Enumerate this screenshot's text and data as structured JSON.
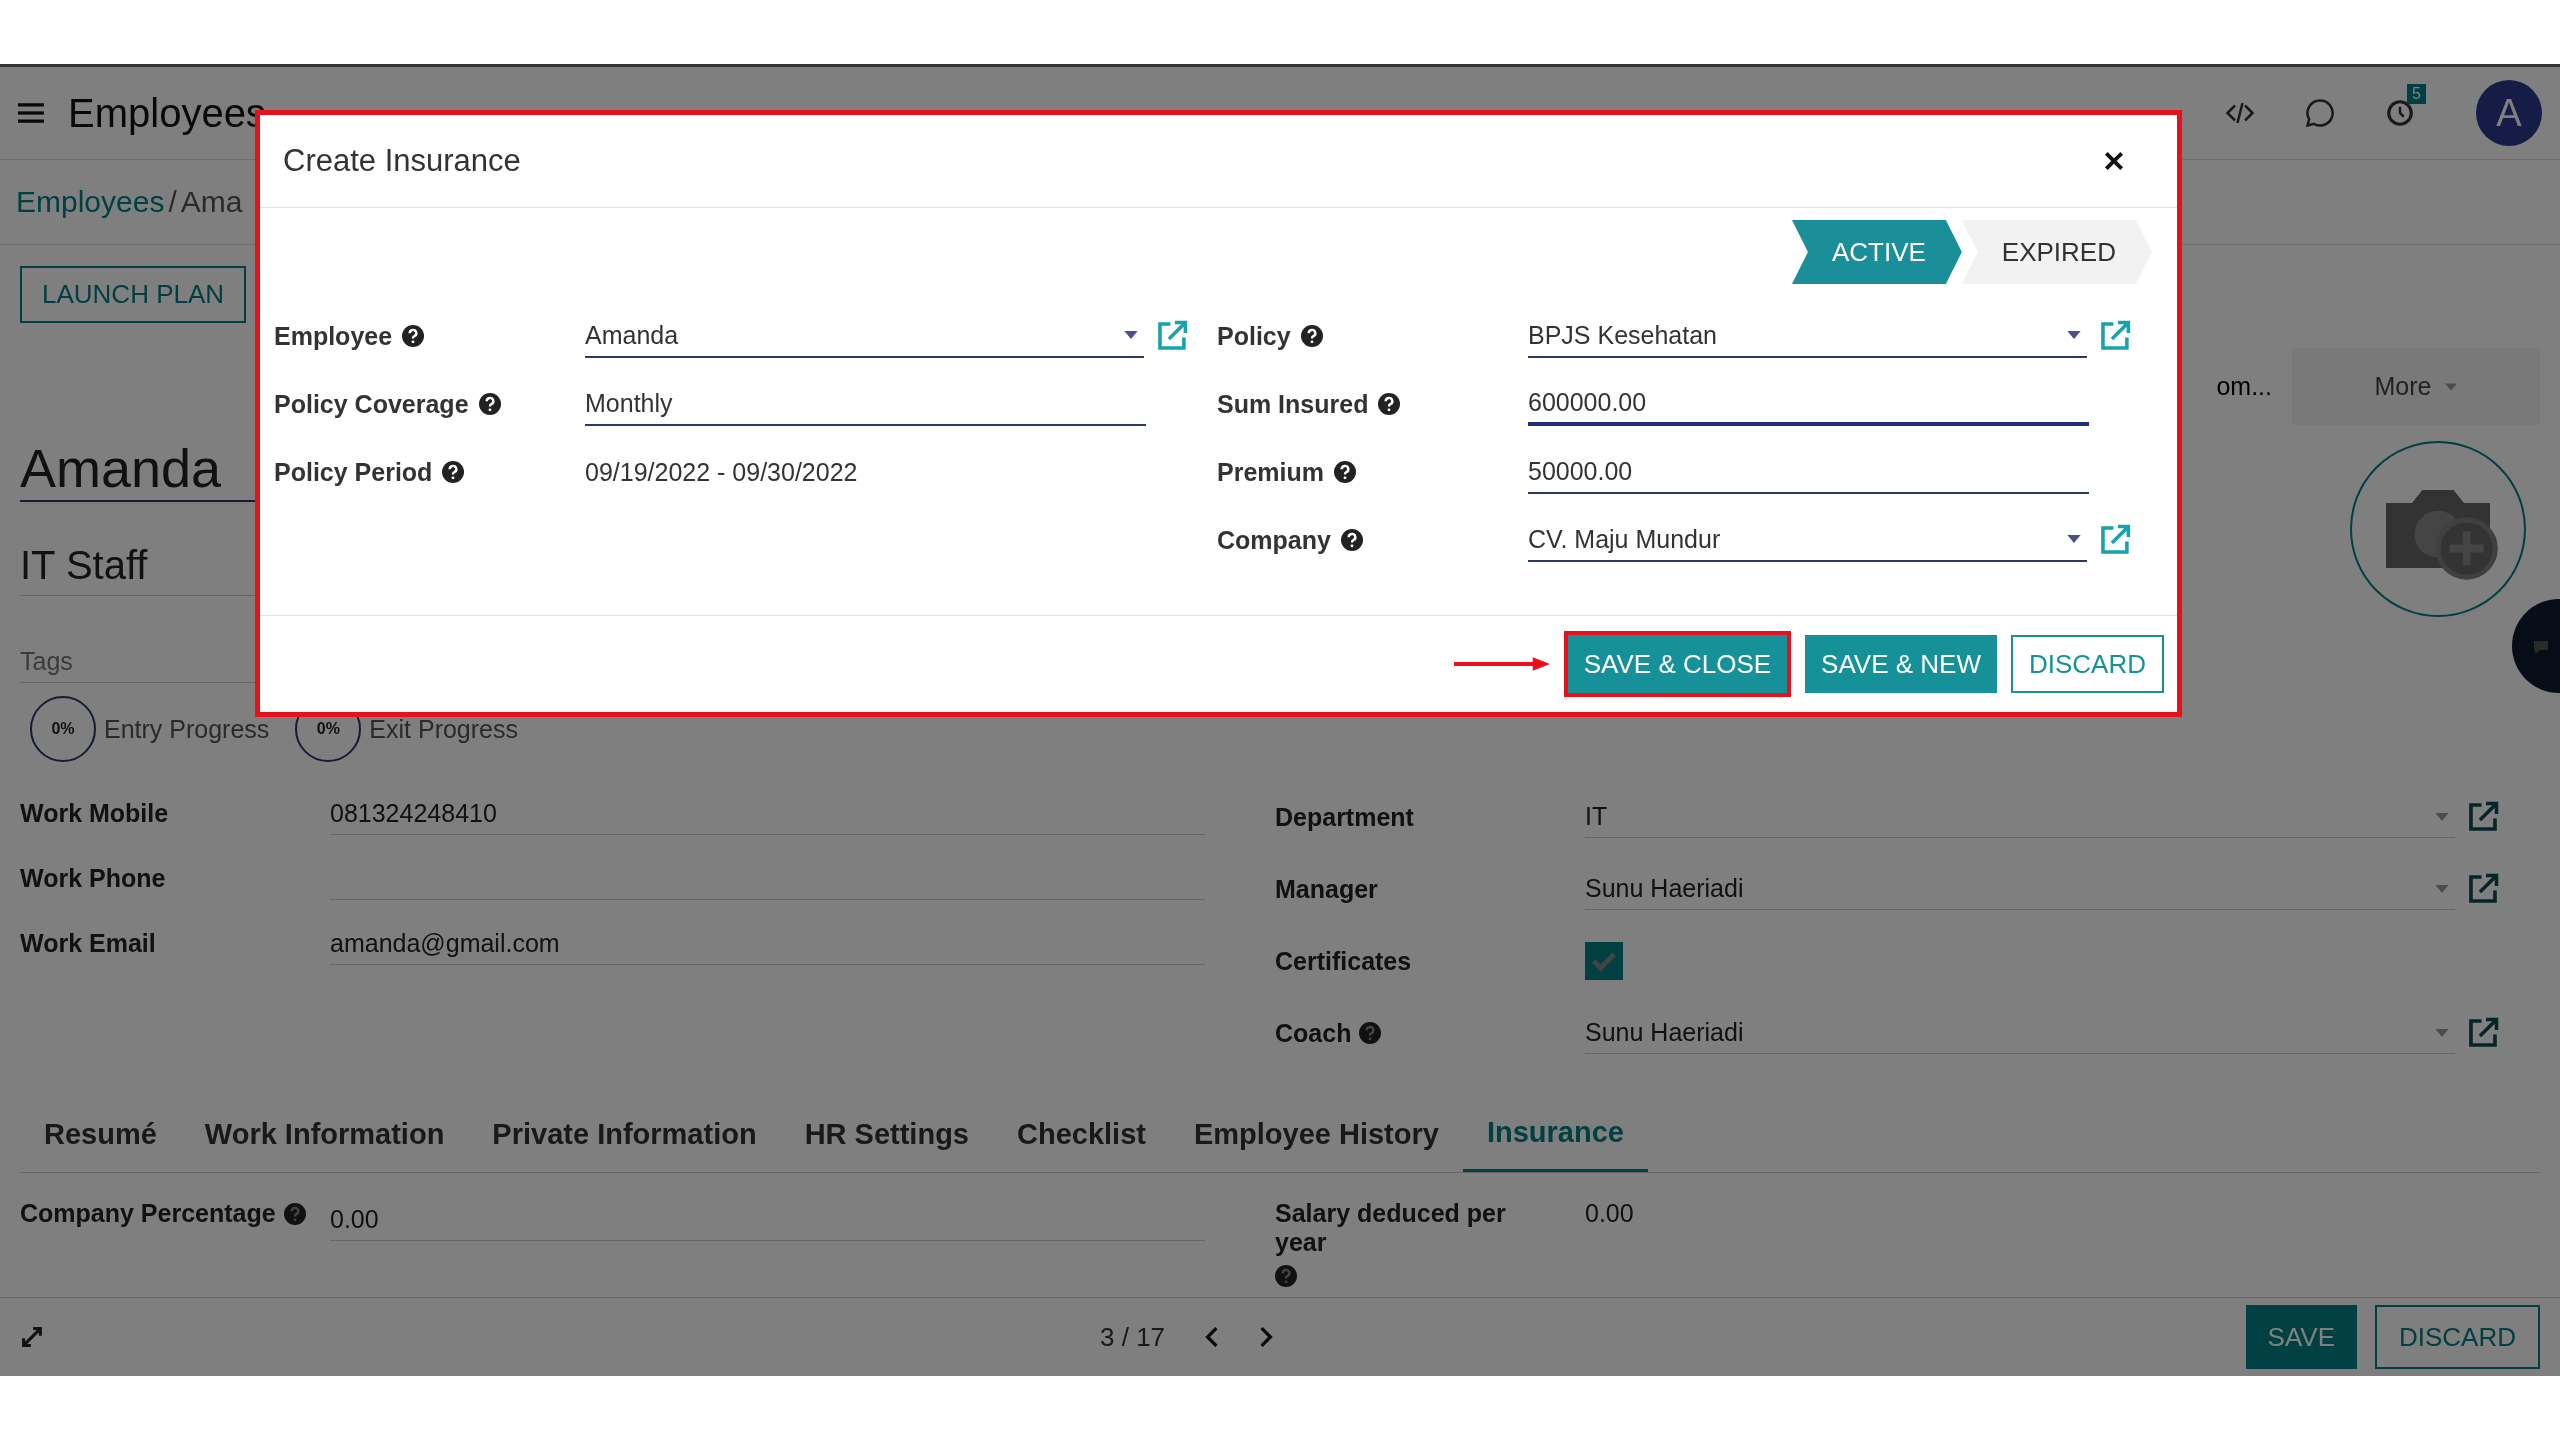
{
  "navbar": {
    "app_title": "Employees",
    "notification_badge": "5",
    "avatar_initial": "A"
  },
  "breadcrumb": {
    "parent": "Employees",
    "separator": "/",
    "current": "Ama"
  },
  "launch_button": "LAUNCH PLAN",
  "smart_buttons": [
    {
      "kind": "stat",
      "label": "om..."
    },
    {
      "kind": "more",
      "label": "More"
    }
  ],
  "employee": {
    "name": "Amanda",
    "job_title": "IT Staff",
    "tags_placeholder": "Tags"
  },
  "progress": [
    {
      "value": "0%",
      "label": "Entry Progress"
    },
    {
      "value": "0%",
      "label": "Exit Progress"
    }
  ],
  "left_fields": [
    {
      "label": "Work Mobile",
      "value": "081324248410"
    },
    {
      "label": "Work Phone"
    },
    {
      "label": "Work Email",
      "value": "amanda@gmail.com"
    }
  ],
  "right_fields": [
    {
      "kind": "many2one",
      "label": "Department",
      "help": false,
      "value": "IT"
    },
    {
      "kind": "many2one",
      "label": "Manager",
      "help": false,
      "value": "Sunu Haeriadi"
    },
    {
      "kind": "checkbox",
      "label": "Certificates",
      "help": false,
      "checked": true
    },
    {
      "kind": "many2one",
      "label": "Coach",
      "help": true,
      "value": "Sunu Haeriadi"
    }
  ],
  "tabs": [
    {
      "label": "Resumé",
      "selected": false
    },
    {
      "label": "Work Information",
      "selected": false
    },
    {
      "label": "Private Information",
      "selected": false
    },
    {
      "label": "HR Settings",
      "selected": false
    },
    {
      "label": "Checklist",
      "selected": false
    },
    {
      "label": "Employee History",
      "selected": false
    },
    {
      "label": "Insurance",
      "selected": true
    }
  ],
  "insurance": {
    "left": {
      "label": "Company Percentage",
      "value": "0.00"
    },
    "right": {
      "label": "Salary deduced per year",
      "value": "0.00"
    }
  },
  "pager": "3 / 17",
  "footer_buttons": [
    {
      "label": "SAVE",
      "kind": "primary"
    },
    {
      "label": "DISCARD",
      "kind": "secondary"
    }
  ],
  "dialog": {
    "title": "Create Insurance",
    "statuses": [
      {
        "label": "ACTIVE",
        "selected": true
      },
      {
        "label": "EXPIRED",
        "selected": false
      }
    ],
    "left_fields": [
      {
        "kind": "many2one",
        "label": "Employee",
        "value": "Amanda",
        "focused": false
      },
      {
        "kind": "input",
        "label": "Policy Coverage",
        "value": "Monthly",
        "focused": false
      },
      {
        "kind": "readonly",
        "label": "Policy Period",
        "value": "09/19/2022 - 09/30/2022",
        "focused": false
      }
    ],
    "right_fields": [
      {
        "kind": "many2one",
        "label": "Policy",
        "value": "BPJS Kesehatan",
        "focused": false
      },
      {
        "kind": "input",
        "label": "Sum Insured",
        "value": "600000.00",
        "focused": true
      },
      {
        "kind": "input",
        "label": "Premium",
        "value": "50000.00",
        "focused": false
      },
      {
        "kind": "many2one",
        "label": "Company",
        "value": "CV. Maju Mundur",
        "focused": false
      }
    ],
    "buttons": [
      {
        "label": "SAVE & CLOSE",
        "kind": "primary",
        "highlighted": true
      },
      {
        "label": "SAVE & NEW",
        "kind": "primary",
        "highlighted": false
      },
      {
        "label": "DISCARD",
        "kind": "secondary",
        "highlighted": false
      }
    ]
  }
}
